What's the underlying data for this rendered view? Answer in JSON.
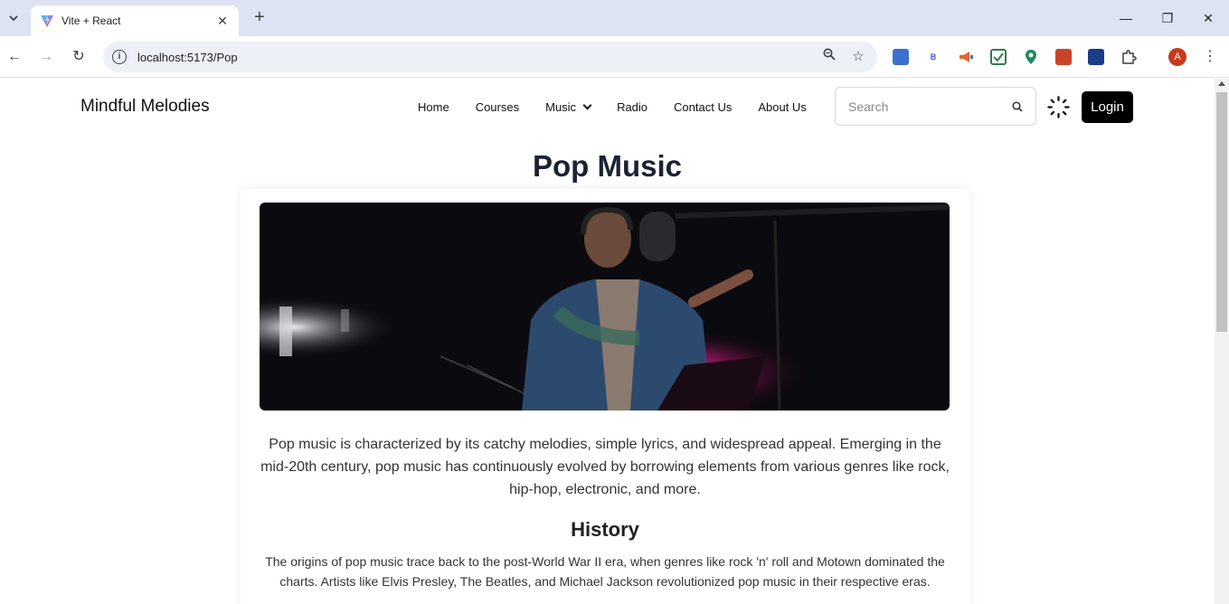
{
  "browser": {
    "tab_title": "Vite + React",
    "url": "localhost:5173/Pop",
    "profile_initial": "A",
    "extension_b_label": "B"
  },
  "site": {
    "brand": "Mindful Melodies",
    "nav": [
      {
        "label": "Home"
      },
      {
        "label": "Courses"
      },
      {
        "label": "Music"
      },
      {
        "label": "Radio"
      },
      {
        "label": "Contact Us"
      },
      {
        "label": "About Us"
      }
    ],
    "search_placeholder": "Search",
    "login_label": "Login"
  },
  "content": {
    "title": "Pop Music",
    "intro": "Pop music is characterized by its catchy melodies, simple lyrics, and widespread appeal. Emerging in the mid-20th century, pop music has continuously evolved by borrowing elements from various genres like rock, hip-hop, electronic, and more.",
    "history_title": "History",
    "history_text": "The origins of pop music trace back to the post-World War II era, when genres like rock 'n' roll and Motown dominated the charts. Artists like Elvis Presley, The Beatles, and Michael Jackson revolutionized pop music in their respective eras."
  },
  "colors": {
    "accent": "#000000",
    "title": "#1b2233",
    "tabstrip": "#dde3f3"
  }
}
